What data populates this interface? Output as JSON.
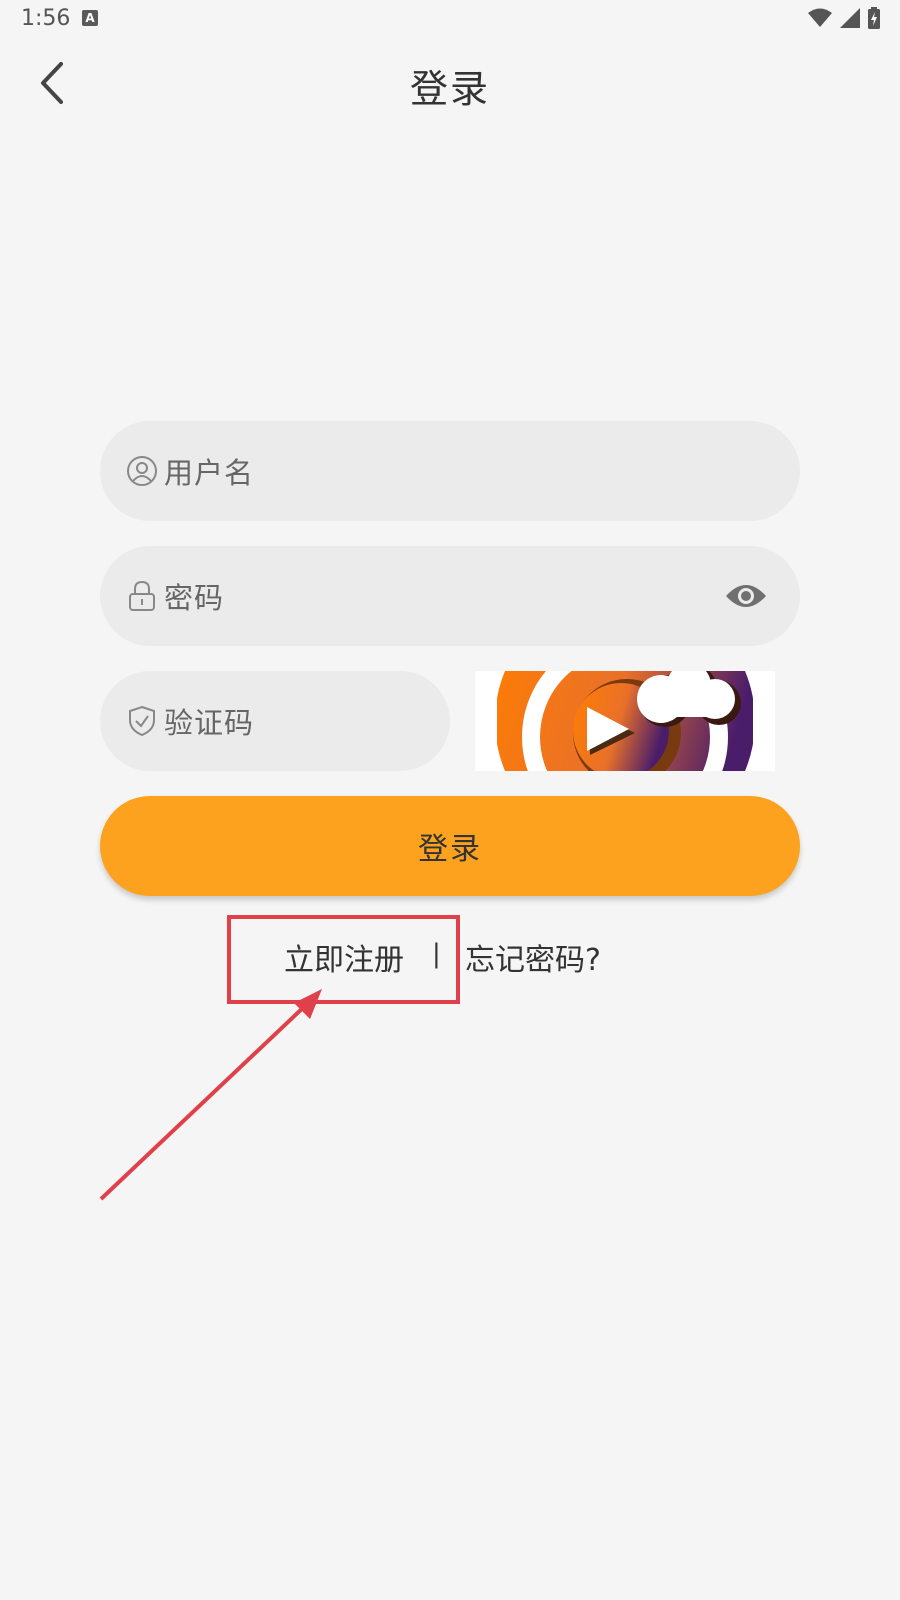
{
  "status_bar": {
    "time": "1:56",
    "notification_icon": "a-icon",
    "icons": [
      "wifi-icon",
      "signal-icon",
      "battery-icon"
    ]
  },
  "header": {
    "title": "登录",
    "back_icon": "chevron-left-icon"
  },
  "form": {
    "username": {
      "placeholder": "用户名",
      "icon": "user-icon"
    },
    "password": {
      "placeholder": "密码",
      "icon": "lock-icon",
      "toggle_icon": "eye-icon"
    },
    "captcha": {
      "placeholder": "验证码",
      "icon": "shield-icon"
    },
    "login_label": "登录"
  },
  "links": {
    "register": "立即注册",
    "separator": "|",
    "forgot": "忘记密码?"
  },
  "colors": {
    "background": "#f5f5f5",
    "field_background": "#ebebeb",
    "accent": "#fca21f",
    "annotation": "#e0404a"
  }
}
